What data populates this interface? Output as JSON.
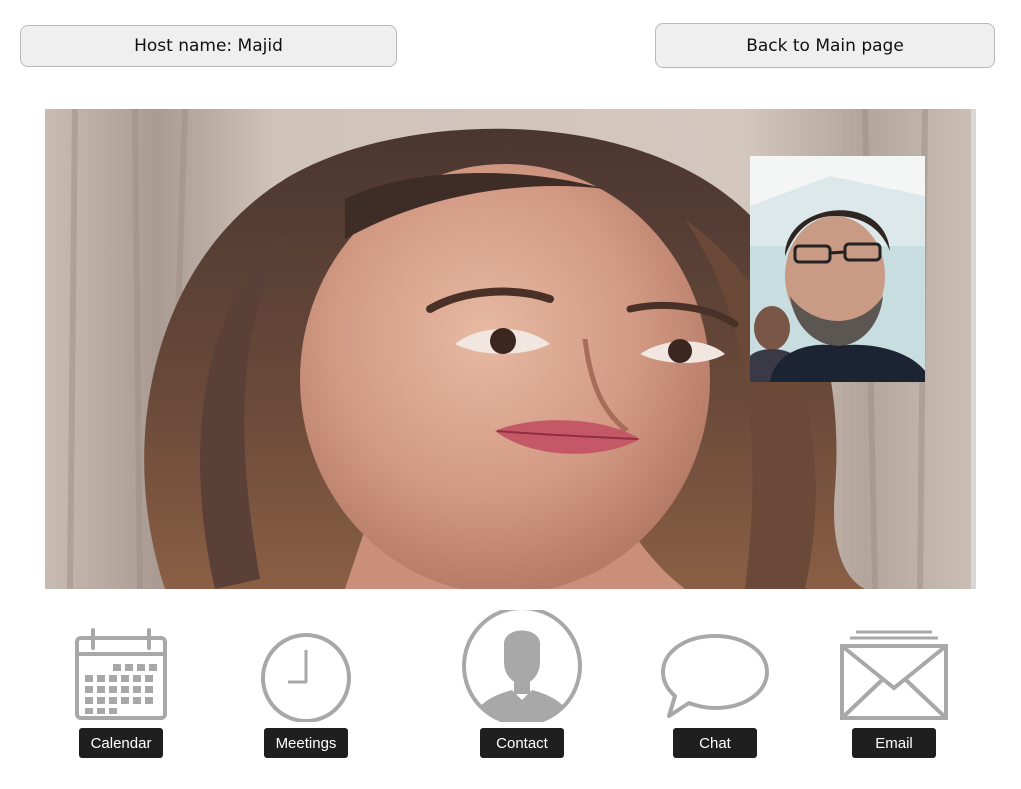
{
  "header": {
    "host_label": "Host name: Majid",
    "back_label": "Back to Main page"
  },
  "video": {
    "main_participant": "remote-video",
    "self_view": "local-video"
  },
  "toolbar": {
    "items": [
      {
        "label": "Calendar",
        "icon": "calendar-icon"
      },
      {
        "label": "Meetings",
        "icon": "clock-icon"
      },
      {
        "label": "Contact",
        "icon": "person-icon"
      },
      {
        "label": "Chat",
        "icon": "speech-bubble-icon"
      },
      {
        "label": "Email",
        "icon": "envelope-icon"
      }
    ]
  },
  "colors": {
    "icon_gray": "#a8a8a8",
    "label_bg": "#1f1f1f",
    "button_bg": "#efefef"
  }
}
